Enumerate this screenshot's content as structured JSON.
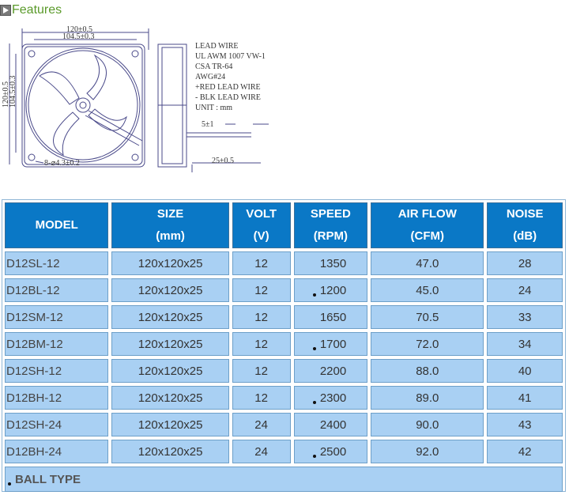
{
  "header": {
    "title": "Features",
    "icon": "play-icon"
  },
  "drawing": {
    "dims": {
      "width_outer": "120±0.5",
      "width_inner": "104.5±0.3",
      "height_outer": "120±0.5",
      "height_inner": "104.5±0.3",
      "holes": "8-⌀4.3±0.2",
      "lead": "5±1",
      "depth": "25±0.5"
    },
    "notes": [
      "LEAD WIRE",
      "UL  AWM 1007 VW-1",
      "CSA TR-64",
      "AWG#24",
      "+RED LEAD WIRE",
      " - BLK LEAD WIRE",
      "UNIT : mm"
    ]
  },
  "table": {
    "headers": [
      {
        "line1": "MODEL",
        "line2": ""
      },
      {
        "line1": "SIZE",
        "line2": "(mm)"
      },
      {
        "line1": "VOLT",
        "line2": "(V)"
      },
      {
        "line1": "SPEED",
        "line2": "(RPM)"
      },
      {
        "line1": "AIR FLOW",
        "line2": "(CFM)"
      },
      {
        "line1": "NOISE",
        "line2": "(dB)"
      }
    ],
    "rows": [
      {
        "model": "D12SL-12",
        "size": "120x120x25",
        "volt": "12",
        "speed": "1350",
        "ball": false,
        "airflow": "47.0",
        "noise": "28"
      },
      {
        "model": "D12BL-12",
        "size": "120x120x25",
        "volt": "12",
        "speed": "1200",
        "ball": true,
        "airflow": "45.0",
        "noise": "24"
      },
      {
        "model": "D12SM-12",
        "size": "120x120x25",
        "volt": "12",
        "speed": "1650",
        "ball": false,
        "airflow": "70.5",
        "noise": "33"
      },
      {
        "model": "D12BM-12",
        "size": "120x120x25",
        "volt": "12",
        "speed": "1700",
        "ball": true,
        "airflow": "72.0",
        "noise": "34"
      },
      {
        "model": "D12SH-12",
        "size": "120x120x25",
        "volt": "12",
        "speed": "2200",
        "ball": false,
        "airflow": "88.0",
        "noise": "40"
      },
      {
        "model": "D12BH-12",
        "size": "120x120x25",
        "volt": "12",
        "speed": "2300",
        "ball": true,
        "airflow": "89.0",
        "noise": "41"
      },
      {
        "model": "D12SH-24",
        "size": "120x120x25",
        "volt": "24",
        "speed": "2400",
        "ball": false,
        "airflow": "90.0",
        "noise": "43"
      },
      {
        "model": "D12BH-24",
        "size": "120x120x25",
        "volt": "24",
        "speed": "2500",
        "ball": true,
        "airflow": "92.0",
        "noise": "42"
      }
    ],
    "footer": "BALL TYPE"
  }
}
